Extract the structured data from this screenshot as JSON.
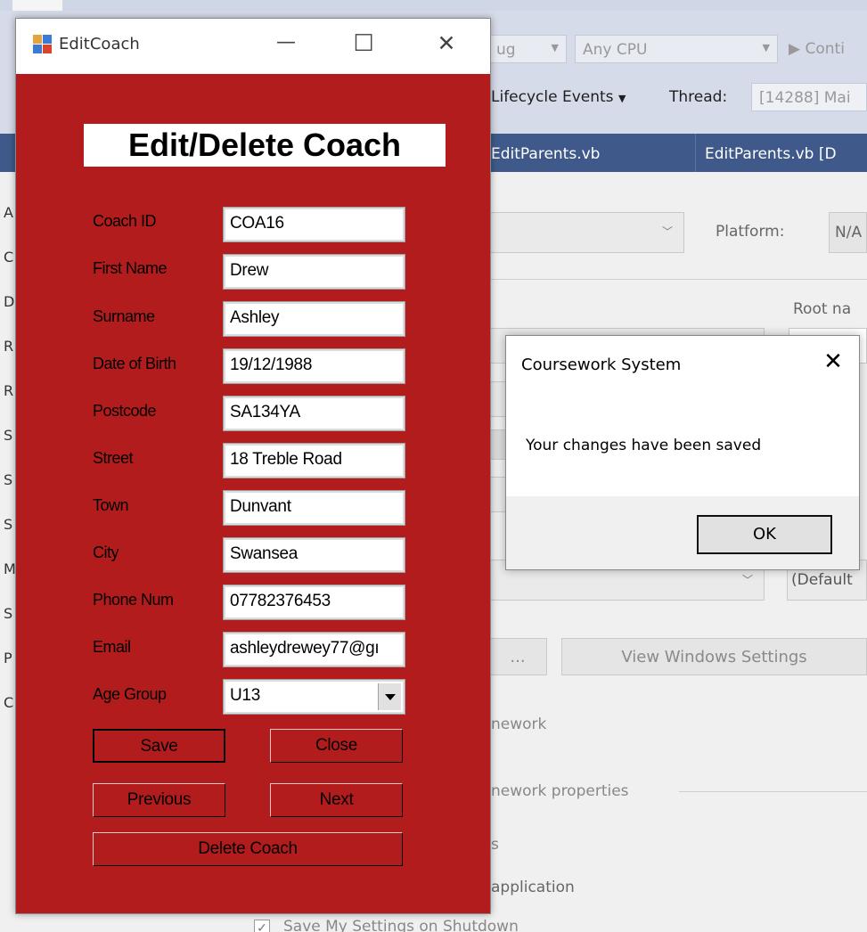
{
  "ide": {
    "config_dropdown": "ug",
    "platform_dropdown": "Any CPU",
    "continue_button": "Conti",
    "lifecycle_label": "Lifecycle Events",
    "thread_label": "Thread:",
    "thread_value": "[14288] Mai",
    "tabs": [
      "EditParents.vb",
      "EditParents.vb [D"
    ],
    "left_letters": [
      "A",
      "C",
      "D",
      "R",
      "R",
      "S",
      "S",
      "S",
      "M",
      "S",
      "P",
      "C"
    ],
    "platform_label": "Platform:",
    "platform_value": "N/A",
    "root_label": "Root na",
    "default_value": "(Default",
    "ellipsis_button": "...",
    "view_windows_settings": "View Windows Settings",
    "framework_text": "nework",
    "framework_properties": "nework properties",
    "s_text": "s",
    "application_text": "application",
    "save_settings": "Save My Settings on Shutdown"
  },
  "window": {
    "title": "EditCoach",
    "minimize": "—",
    "maximize": "☐",
    "close": "✕"
  },
  "form": {
    "heading": "Edit/Delete Coach",
    "fields": [
      {
        "label": "Coach ID",
        "value": "COA16"
      },
      {
        "label": "First Name",
        "value": "Drew"
      },
      {
        "label": "Surname",
        "value": "Ashley"
      },
      {
        "label": "Date of Birth",
        "value": "19/12/1988"
      },
      {
        "label": "Postcode",
        "value": "SA134YA"
      },
      {
        "label": "Street",
        "value": "18 Treble Road"
      },
      {
        "label": "Town",
        "value": "Dunvant"
      },
      {
        "label": "City",
        "value": "Swansea"
      },
      {
        "label": "Phone Num",
        "value": "07782376453"
      },
      {
        "label": "Email",
        "value": "ashleydrewey77@gı"
      }
    ],
    "age_group": {
      "label": "Age Group",
      "value": "U13"
    },
    "buttons": {
      "save": "Save",
      "close": "Close",
      "previous": "Previous",
      "next": "Next",
      "delete": "Delete Coach"
    }
  },
  "message_box": {
    "title": "Coursework System",
    "close": "✕",
    "text": "Your changes have been saved",
    "ok": "OK"
  },
  "colors": {
    "form_background": "#b31c1c",
    "ide_tab_bar": "#3f5a8a"
  }
}
